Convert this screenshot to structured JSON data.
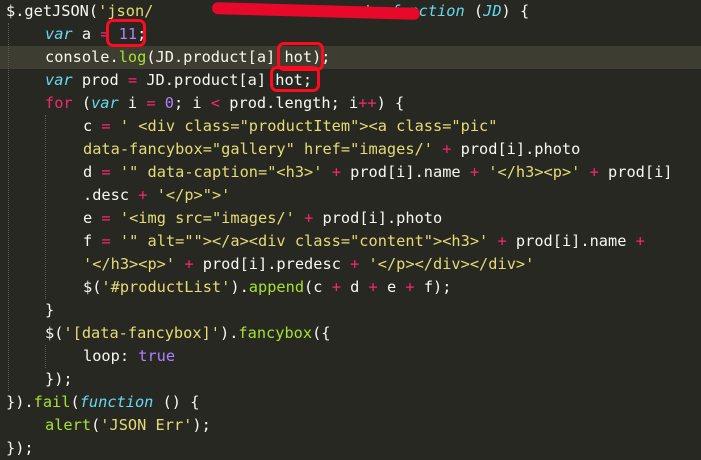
{
  "code": {
    "line1": {
      "a": "$.getJSON(",
      "b": "'json/",
      "c": "', ",
      "d": "function",
      "e": " (",
      "f": "JD",
      "g": ") {"
    },
    "line2": {
      "a": "var",
      "b": " a ",
      "c": "=",
      "d": " ",
      "e": "11",
      "f": ";"
    },
    "line3": {
      "a": "console.",
      "b": "log",
      "c": "(JD.product[a] hot);"
    },
    "line4": {
      "a": "var",
      "b": " prod ",
      "c": "=",
      "d": " JD.product[a] hot;"
    },
    "line5": {
      "a": "for",
      "b": " (",
      "c": "var",
      "d": " i ",
      "e": "=",
      "f": " ",
      "g": "0",
      "h": "; i ",
      "i": "<",
      "j": " prod.length; i",
      "k": "++",
      "l": ") {"
    },
    "line6": {
      "a": "c ",
      "b": "=",
      "c": " ",
      "d": "' <div class=\"productItem\"><a class=\"pic\""
    },
    "line7": {
      "a": "data-fancybox=\"gallery\" href=\"images/'",
      "b": " ",
      "c": "+",
      "d": " prod[i].photo"
    },
    "line8": {
      "a": "d ",
      "b": "=",
      "c": " ",
      "d": "'\" data-caption=\"<h3>'",
      "e": " ",
      "f": "+",
      "g": " prod[i].name ",
      "h": "+",
      "i": " ",
      "j": "'</h3><p>'",
      "k": " ",
      "l": "+",
      "m": " prod[i]"
    },
    "line9": {
      "a": ".desc ",
      "b": "+",
      "c": " ",
      "d": "'</p>\">'"
    },
    "line10": {
      "a": "e ",
      "b": "=",
      "c": " ",
      "d": "'<img src=\"images/'",
      "e": " ",
      "f": "+",
      "g": " prod[i].photo"
    },
    "line11": {
      "a": "f ",
      "b": "=",
      "c": " ",
      "d": "'\" alt=\"\"></a><div class=\"content\"><h3>'",
      "e": " ",
      "f": "+",
      "g": " prod[i].name ",
      "h": "+"
    },
    "line12": {
      "a": "'</h3><p>'",
      "b": " ",
      "c": "+",
      "d": " prod[i].predesc ",
      "e": "+",
      "f": " ",
      "g": "'</p></div></div>'"
    },
    "line13": {
      "a": "$(",
      "b": "'#productList'",
      "c": ").",
      "d": "append",
      "e": "(c ",
      "f": "+",
      "g": " d ",
      "h": "+",
      "i": " e ",
      "j": "+",
      "k": " f);"
    },
    "line14": {
      "a": "}"
    },
    "line15": {
      "a": "$(",
      "b": "'[data-fancybox]'",
      "c": ").",
      "d": "fancybox",
      "e": "({"
    },
    "line16": {
      "a": "loop",
      "b": ": ",
      "c": "true"
    },
    "line17": {
      "a": "});"
    },
    "line18": {
      "a": "}).",
      "b": "fail",
      "c": "(",
      "d": "function",
      "e": " () {"
    },
    "line19": {
      "a": "alert",
      "b": "(",
      "c": "'JSON Err'",
      "d": ");"
    },
    "line20": {
      "a": "});"
    }
  },
  "theme": {
    "background": "#272822",
    "highlight": "#3e3d32",
    "keyword": "#66d9ef",
    "string": "#e6db74",
    "number": "#ae81ff",
    "operator": "#f92672",
    "function": "#a6e22e",
    "annotation": "#ff0a1e"
  }
}
